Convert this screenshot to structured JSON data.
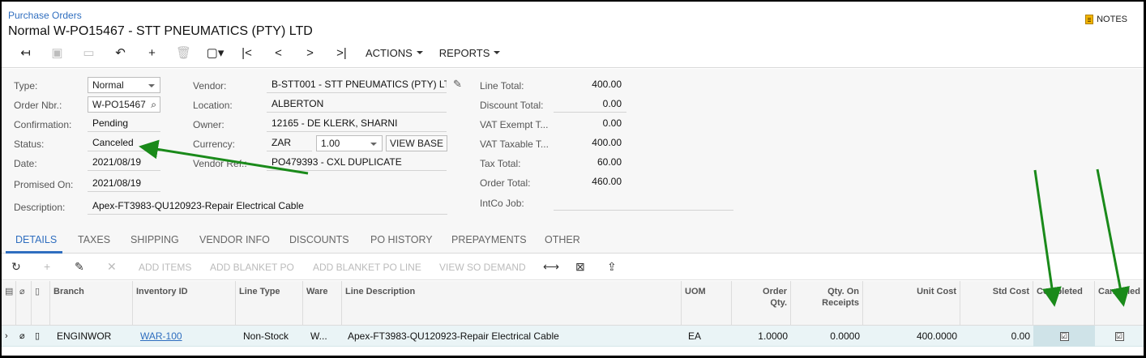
{
  "header": {
    "breadcrumb": "Purchase Orders",
    "title": "Normal W-PO15467 - STT PNEUMATICS (PTY) LTD",
    "notes_label": "NOTES"
  },
  "toolbar": {
    "actions_label": "ACTIONS",
    "reports_label": "REPORTS"
  },
  "form": {
    "type_label": "Type:",
    "type_value": "Normal",
    "order_nbr_label": "Order Nbr.:",
    "order_nbr_value": "W-PO15467",
    "confirmation_label": "Confirmation:",
    "confirmation_value": "Pending",
    "status_label": "Status:",
    "status_value": "Canceled",
    "date_label": "Date:",
    "date_value": "2021/08/19",
    "promised_label": "Promised On:",
    "promised_value": "2021/08/19",
    "description_label": "Description:",
    "description_value": "Apex-FT3983-QU120923-Repair Electrical Cable",
    "vendor_label": "Vendor:",
    "vendor_value": "B-STT001 - STT PNEUMATICS (PTY) LT",
    "location_label": "Location:",
    "location_value": "ALBERTON",
    "owner_label": "Owner:",
    "owner_value": "12165 - DE KLERK, SHARNI",
    "currency_label": "Currency:",
    "currency_value": "ZAR",
    "rate_value": "1.00",
    "view_base_label": "VIEW BASE",
    "vendor_ref_label": "Vendor Ref.:",
    "vendor_ref_value": "PO479393 - CXL DUPLICATE",
    "line_total_label": "Line Total:",
    "line_total_value": "400.00",
    "discount_total_label": "Discount Total:",
    "discount_total_value": "0.00",
    "vat_exempt_label": "VAT Exempt T...",
    "vat_exempt_value": "0.00",
    "vat_taxable_label": "VAT Taxable T...",
    "vat_taxable_value": "400.00",
    "tax_total_label": "Tax Total:",
    "tax_total_value": "60.00",
    "order_total_label": "Order Total:",
    "order_total_value": "460.00",
    "intco_label": "IntCo Job:"
  },
  "tabs": [
    "DETAILS",
    "TAXES",
    "SHIPPING",
    "VENDOR INFO",
    "DISCOUNTS",
    "PO HISTORY",
    "PREPAYMENTS",
    "OTHER"
  ],
  "gridbar": {
    "add_items": "ADD ITEMS",
    "add_blanket_po": "ADD BLANKET PO",
    "add_blanket_po_line": "ADD BLANKET PO LINE",
    "view_so_demand": "VIEW SO DEMAND"
  },
  "columns": {
    "branch": "Branch",
    "inventory_id": "Inventory ID",
    "line_type": "Line Type",
    "warehouse": "Ware",
    "line_description": "Line Description",
    "uom": "UOM",
    "order_qty_1": "Order",
    "order_qty_2": "Qty.",
    "qty_on_receipts_1": "Qty. On",
    "qty_on_receipts_2": "Receipts",
    "unit_cost": "Unit Cost",
    "std_cost": "Std Cost",
    "completed": "Completed",
    "cancelled": "Cancelled"
  },
  "row": {
    "branch": "ENGINWOR",
    "inventory_id": "WAR-100",
    "line_type": "Non-Stock",
    "warehouse": "W...",
    "line_description": "Apex-FT3983-QU120923-Repair Electrical Cable",
    "uom": "EA",
    "order_qty": "1.0000",
    "qty_on_receipts": "0.0000",
    "unit_cost": "400.0000",
    "std_cost": "0.00",
    "completed_mark": "☑",
    "cancelled_mark": "☑"
  },
  "colors": {
    "accent": "#2f6ebf",
    "annotation_arrow": "#1a8a1a"
  }
}
